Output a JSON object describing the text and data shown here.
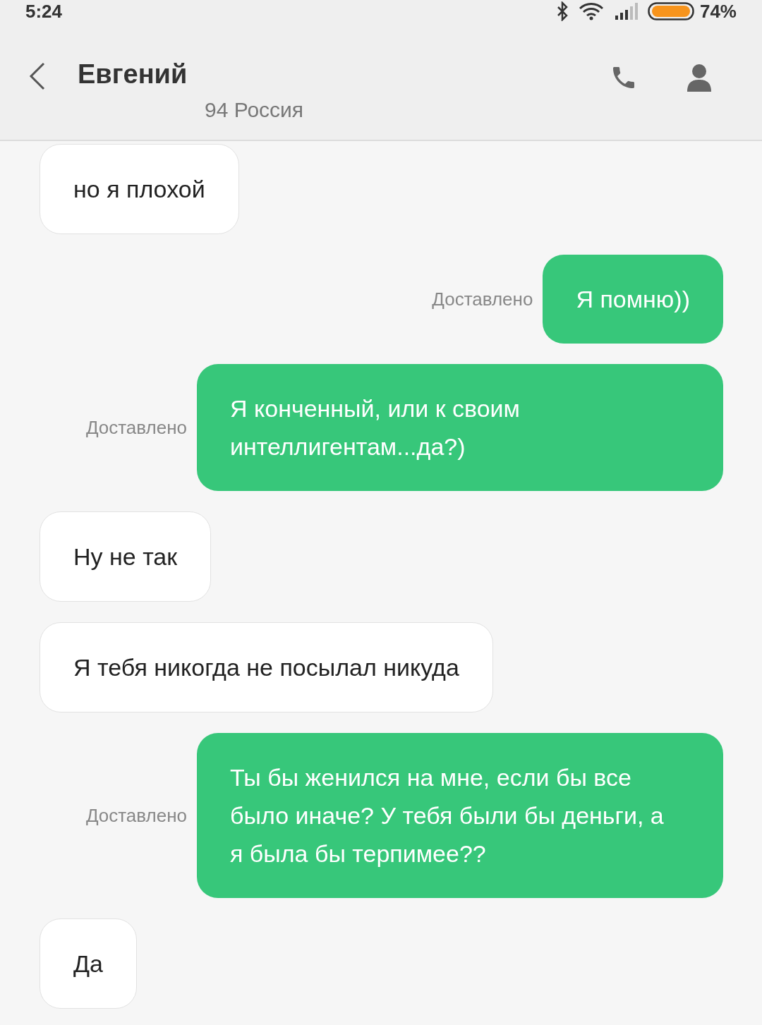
{
  "status_bar": {
    "time": "5:24",
    "battery": "74%"
  },
  "header": {
    "title": "Евгений",
    "subtitle": "94 Россия"
  },
  "messages": [
    {
      "kind": "received",
      "text": "но я плохой"
    },
    {
      "kind": "sent",
      "text": "Я помню))",
      "status": "Доставлено"
    },
    {
      "kind": "sent",
      "text": "Я конченный, или к своим интеллигентам...да?)",
      "status": "Доставлено"
    },
    {
      "kind": "received",
      "text": "Ну не так"
    },
    {
      "kind": "received",
      "text": "Я тебя никогда не посылал никуда"
    },
    {
      "kind": "sent",
      "text": "Ты бы женился на мне, если бы все было иначе? У тебя были бы деньги, а я была бы терпимее??",
      "status": "Доставлено"
    },
    {
      "kind": "received",
      "text": "Да"
    }
  ]
}
